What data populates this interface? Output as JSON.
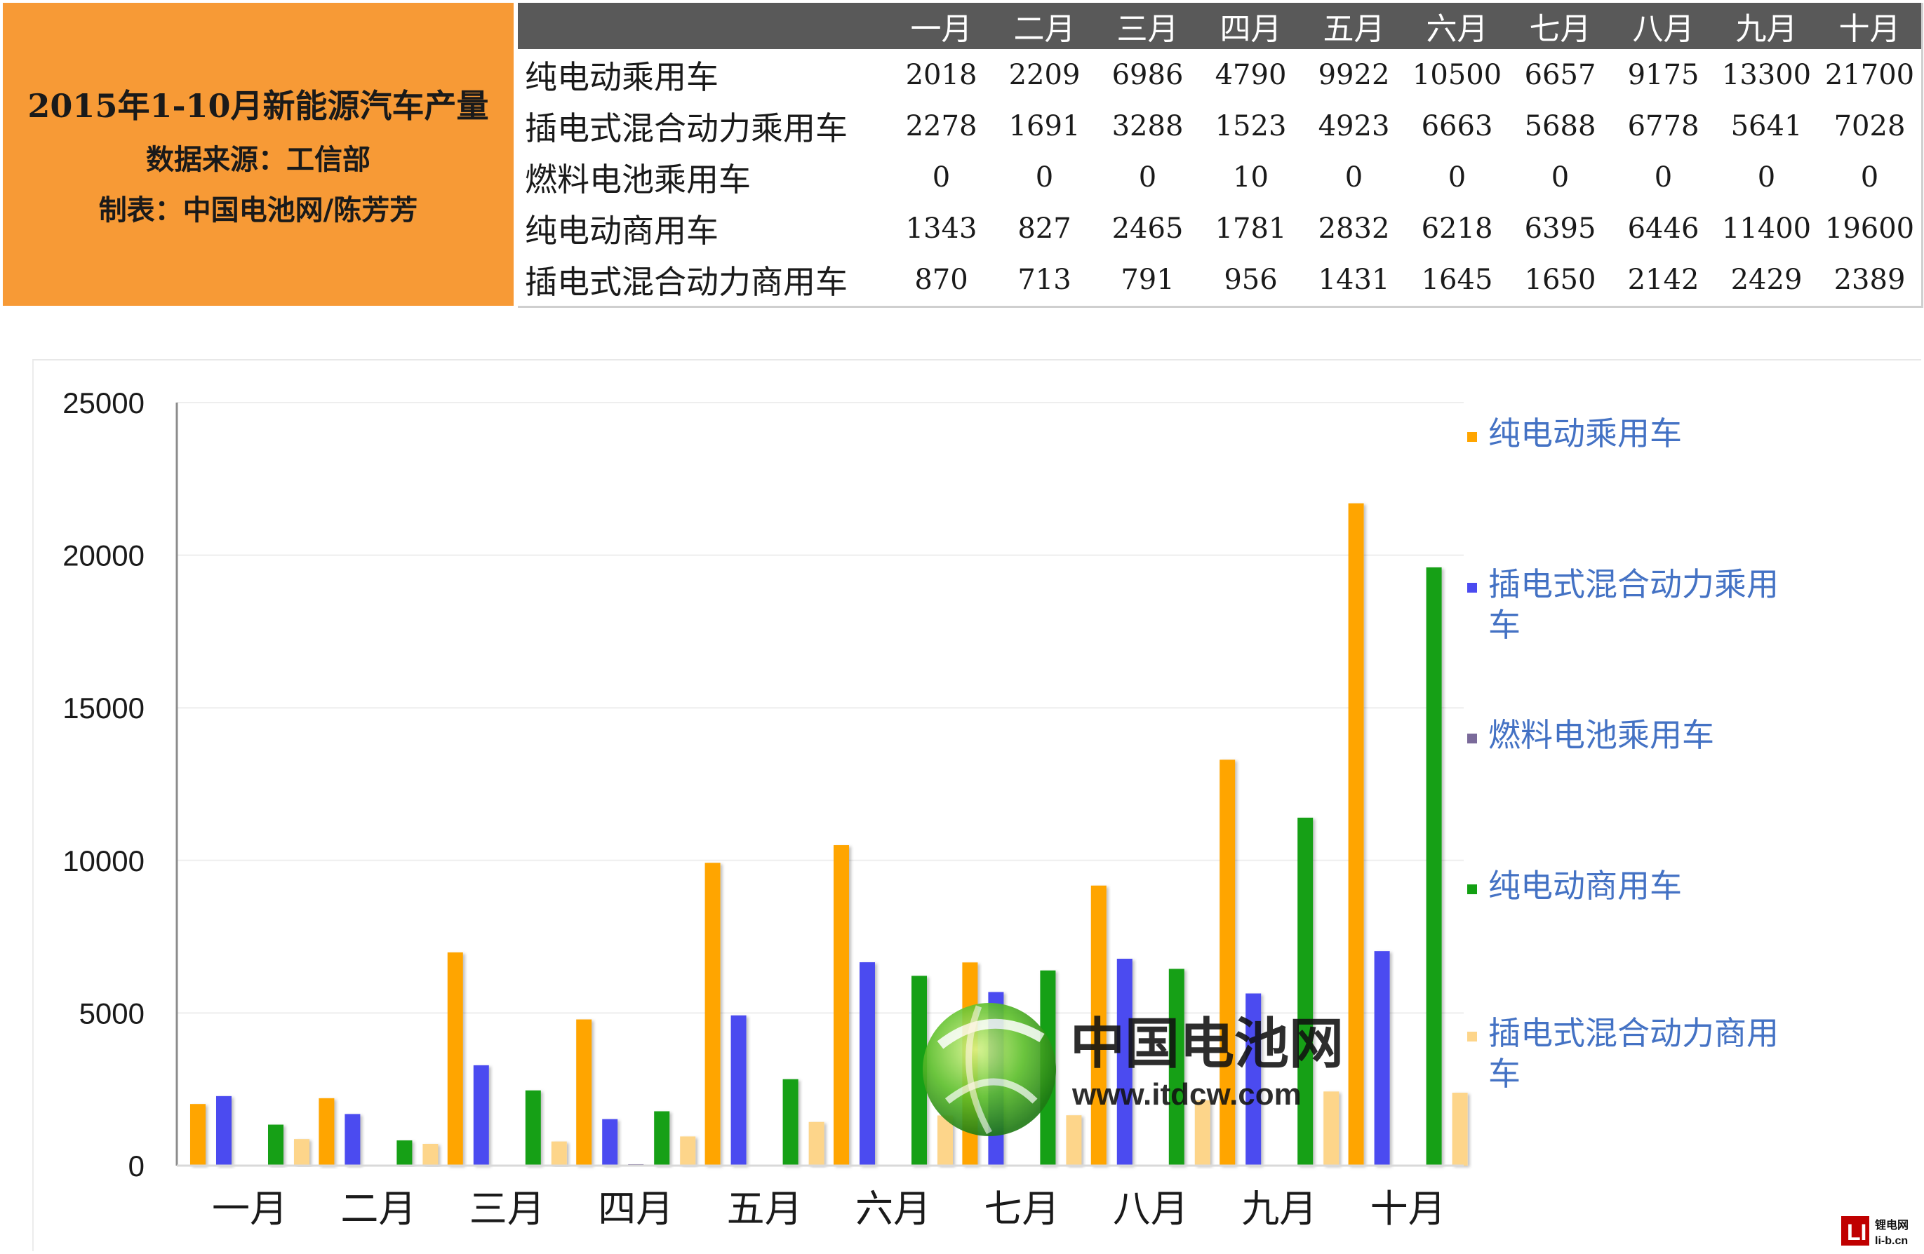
{
  "header": {
    "title": "2015年1-10月新能源汽车产量",
    "source": "数据来源：工信部",
    "author": "制表：中国电池网/陈芳芳"
  },
  "table": {
    "months": [
      "一月",
      "二月",
      "三月",
      "四月",
      "五月",
      "六月",
      "七月",
      "八月",
      "九月",
      "十月"
    ],
    "rows": [
      {
        "label": "纯电动乘用车",
        "values": [
          "2018",
          "2209",
          "6986",
          "4790",
          "9922",
          "10500",
          "6657",
          "9175",
          "13300",
          "21700"
        ]
      },
      {
        "label": "插电式混合动力乘用车",
        "values": [
          "2278",
          "1691",
          "3288",
          "1523",
          "4923",
          "6663",
          "5688",
          "6778",
          "5641",
          "7028"
        ]
      },
      {
        "label": "燃料电池乘用车",
        "values": [
          "0",
          "0",
          "0",
          "10",
          "0",
          "0",
          "0",
          "0",
          "0",
          "0"
        ]
      },
      {
        "label": "纯电动商用车",
        "values": [
          "1343",
          "827",
          "2465",
          "1781",
          "2832",
          "6218",
          "6395",
          "6446",
          "11400",
          "19600"
        ]
      },
      {
        "label": "插电式混合动力商用车",
        "values": [
          "870",
          "713",
          "791",
          "956",
          "1431",
          "1645",
          "1650",
          "2142",
          "2429",
          "2389"
        ]
      }
    ]
  },
  "chart_data": {
    "type": "bar",
    "categories": [
      "一月",
      "二月",
      "三月",
      "四月",
      "五月",
      "六月",
      "七月",
      "八月",
      "九月",
      "十月"
    ],
    "ylim": [
      0,
      25000
    ],
    "yticks": [
      0,
      5000,
      10000,
      15000,
      20000,
      25000
    ],
    "grid": true,
    "legend_position": "right",
    "series": [
      {
        "name": "纯电动乘用车",
        "color": "#ffa500",
        "values": [
          2018,
          2209,
          6986,
          4790,
          9922,
          10500,
          6657,
          9175,
          13300,
          21700
        ]
      },
      {
        "name": "插电式混合动力乘用车",
        "color": "#4b4bf0",
        "values": [
          2278,
          1691,
          3288,
          1523,
          4923,
          6663,
          5688,
          6778,
          5641,
          7028
        ]
      },
      {
        "name": "燃料电池乘用车",
        "color": "#7a6a9a",
        "values": [
          0,
          0,
          0,
          10,
          0,
          0,
          0,
          0,
          0,
          0
        ]
      },
      {
        "name": "纯电动商用车",
        "color": "#13a013",
        "values": [
          1343,
          827,
          2465,
          1781,
          2832,
          6218,
          6395,
          6446,
          11400,
          19600
        ]
      },
      {
        "name": "插电式混合动力商用车",
        "color": "#fdd58a",
        "values": [
          870,
          713,
          791,
          956,
          1431,
          1645,
          1650,
          2142,
          2429,
          2389
        ]
      }
    ]
  },
  "watermark": {
    "brand": "中国电池网",
    "url": "www.itdcw.com",
    "corner_brand": "锂电网",
    "corner_url": "li-b.cn"
  },
  "colors": {
    "title_bg": "#f79a36",
    "table_header_bg": "#595959"
  }
}
